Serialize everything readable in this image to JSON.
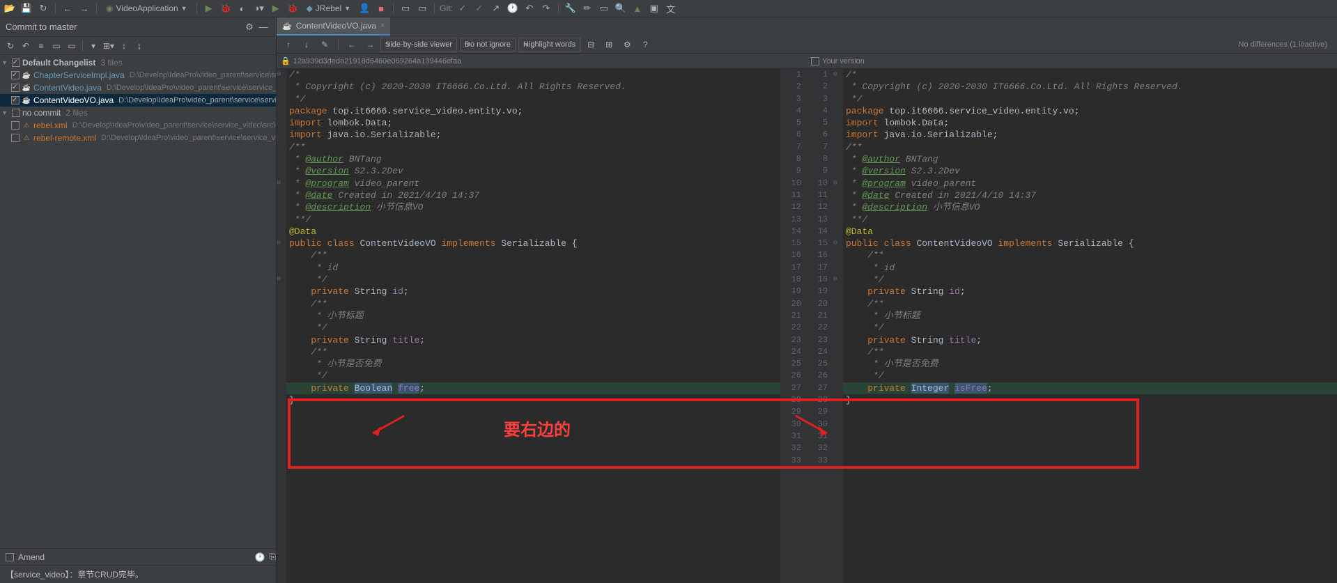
{
  "toolbar": {
    "run_config": "VideoApplication",
    "jrebel": "JRebel",
    "git_label": "Git:"
  },
  "commit_panel": {
    "title": "Commit to master",
    "changelist_default": "Default Changelist",
    "changelist_default_count": "3 files",
    "no_commit": "no commit",
    "no_commit_count": "2 files",
    "files": [
      {
        "name": "ChapterServiceImpl.java",
        "path": "D:\\Develop\\IdeaPro\\video_parent\\service\\service_vid..."
      },
      {
        "name": "ContentVideo.java",
        "path": "D:\\Develop\\IdeaPro\\video_parent\\service\\service_vid..."
      },
      {
        "name": "ContentVideoVO.java",
        "path": "D:\\Develop\\IdeaPro\\video_parent\\service\\service..."
      }
    ],
    "nocommit_files": [
      {
        "name": "rebel.xml",
        "path": "D:\\Develop\\IdeaPro\\video_parent\\service\\service_video\\src\\m..."
      },
      {
        "name": "rebel-remote.xml",
        "path": "D:\\Develop\\IdeaPro\\video_parent\\service\\service_vid..."
      }
    ],
    "amend": "Amend",
    "commit_msg": "【service_video】：章节CRUD完毕。"
  },
  "editor": {
    "tab": "ContentVideoVO.java"
  },
  "diff": {
    "viewer_mode": "Side-by-side viewer",
    "ignore_mode": "Do not ignore",
    "highlight_mode": "Highlight words",
    "status": "No differences (1 inactive)",
    "commit_hash": "12a939d3deda21918d6460e069264a139446efaa",
    "your_version": "Your version"
  },
  "code": {
    "lines": [
      "/*",
      " * Copyright (c) 2020-2030 IT6666.Co.Ltd. All Rights Reserved.",
      " */",
      "package top.it6666.service_video.entity.vo;",
      "",
      "import lombok.Data;",
      "",
      "import java.io.Serializable;",
      "",
      "/**",
      " * @author BNTang",
      " * @version S2.3.2Dev",
      " * @program video_parent",
      " * @date Created in 2021/4/10 14:37",
      " * @description 小节信息VO",
      " **/",
      "@Data",
      "public class ContentVideoVO implements Serializable {",
      "    /**",
      "     * id",
      "     */",
      "    private String id;",
      "",
      "    /**",
      "     * 小节标题",
      "     */",
      "    private String title;",
      "",
      "    /**",
      "     * 小节是否免费",
      "     */",
      "    private Boolean free;",
      "}"
    ],
    "right_diff_line": "    private Integer isFree;"
  },
  "annotation": {
    "text": "要右边的"
  }
}
